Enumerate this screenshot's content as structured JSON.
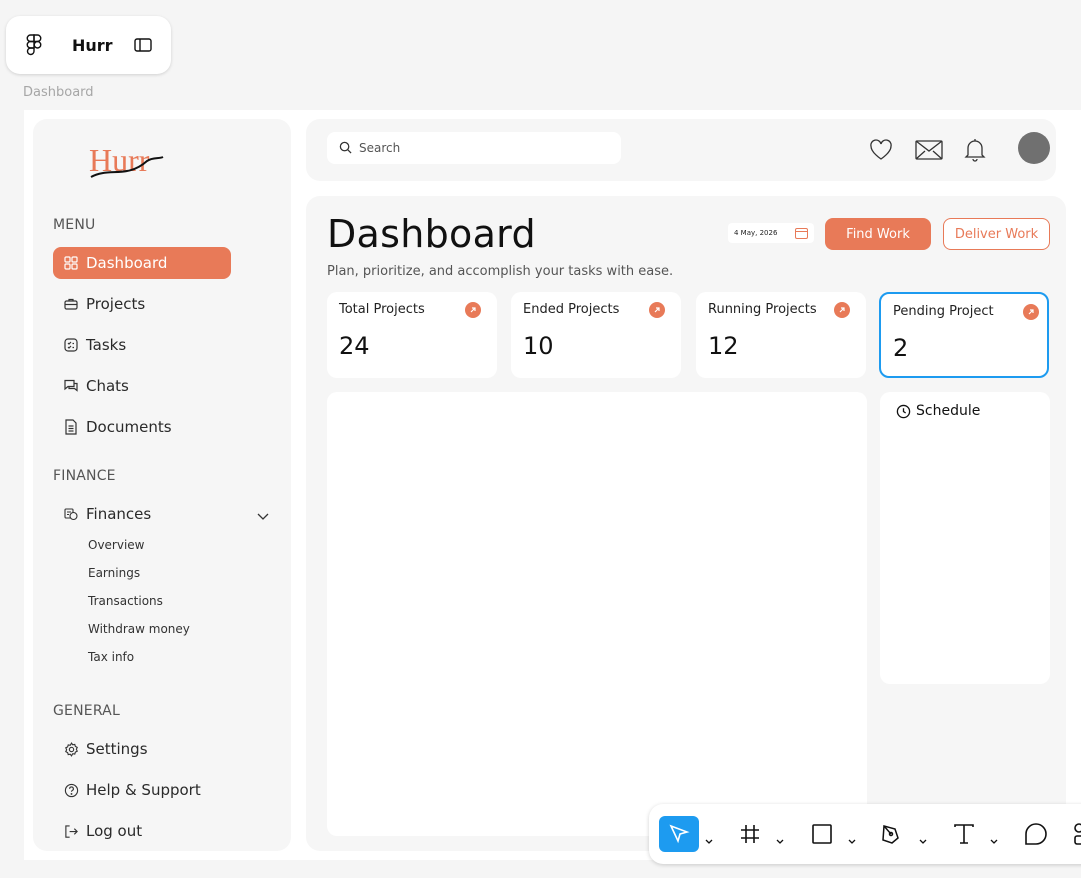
{
  "file": {
    "name": "Hurr"
  },
  "frame_label": "Dashboard",
  "brand": {
    "logo_text": "Hurr",
    "accent": "#e87a58"
  },
  "sidebar": {
    "menu_title": "MENU",
    "menu_items": [
      {
        "label": "Dashboard",
        "icon": "grid-icon",
        "active": true
      },
      {
        "label": "Projects",
        "icon": "briefcase-icon"
      },
      {
        "label": "Tasks",
        "icon": "task-icon"
      },
      {
        "label": "Chats",
        "icon": "chat-icon"
      },
      {
        "label": "Documents",
        "icon": "document-icon"
      }
    ],
    "finance_title": "FINANCE",
    "finance_item": {
      "label": "Finances",
      "icon": "coins-icon"
    },
    "finance_sub": [
      "Overview",
      "Earnings",
      "Transactions",
      "Withdraw money",
      "Tax info"
    ],
    "general_title": "GENERAL",
    "general_items": [
      {
        "label": "Settings",
        "icon": "gear-icon"
      },
      {
        "label": "Help & Support",
        "icon": "help-icon"
      },
      {
        "label": "Log out",
        "icon": "logout-icon"
      }
    ]
  },
  "topbar": {
    "search_placeholder": "Search"
  },
  "main": {
    "title": "Dashboard",
    "subtitle": "Plan, prioritize, and accomplish your tasks with ease.",
    "date": "4 May, 2026",
    "find_work": "Find Work",
    "deliver_work": "Deliver Work",
    "stats": [
      {
        "label": "Total Projects",
        "value": "24"
      },
      {
        "label": "Ended Projects",
        "value": "10"
      },
      {
        "label": "Running Projects",
        "value": "12"
      },
      {
        "label": "Pending Project",
        "value": "2"
      }
    ],
    "schedule_title": "Schedule"
  },
  "colors": {
    "selection": "#1d9bf0",
    "panel": "#f6f6f6"
  }
}
